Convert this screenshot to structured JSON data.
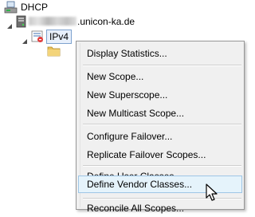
{
  "tree": {
    "root_label": "DHCP",
    "server_label_suffix": ".unicon-ka.de",
    "ipv4_label": "IPv4"
  },
  "context_menu": {
    "items": [
      {
        "label": "Display Statistics..."
      },
      {
        "label": "New Scope..."
      },
      {
        "label": "New Superscope..."
      },
      {
        "label": "New Multicast Scope..."
      },
      {
        "label": "Configure Failover..."
      },
      {
        "label": "Replicate Failover Scopes..."
      },
      {
        "label": "Define User Classes..."
      },
      {
        "label": "Define Vendor Classes..."
      },
      {
        "label": "Reconcile All Scopes..."
      }
    ],
    "hovered_item": "Define Vendor Classes..."
  },
  "icons": [
    "dhcp-root-icon",
    "server-icon",
    "ipv4-icon",
    "folder-icon",
    "expand-icon",
    "mouse-cursor-icon"
  ]
}
